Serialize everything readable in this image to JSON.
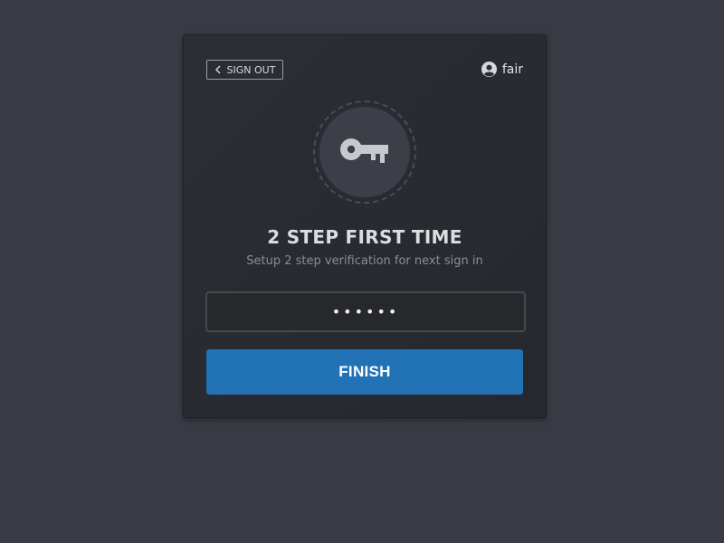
{
  "header": {
    "signout_label": "SIGN OUT",
    "signout_icon": "chevron-left-icon",
    "username": "fair",
    "user_icon": "user-circle-icon"
  },
  "main": {
    "icon": "key-icon",
    "title": "2 STEP FIRST TIME",
    "subtitle": "Setup 2 step verification for next sign in",
    "code_value": "••••••",
    "finish_label": "FINISH"
  },
  "colors": {
    "page_background": "#383b44",
    "card_background": "#2b2e35",
    "accent": "#2273b5",
    "icon_gray": "#c8c9cc"
  }
}
